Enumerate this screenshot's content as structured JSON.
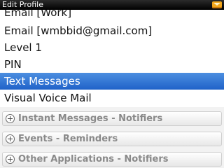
{
  "titlebar": {
    "title": "Edit Profile",
    "icon": "message-icon"
  },
  "list": {
    "items": [
      {
        "label": "Email [Work]"
      },
      {
        "label": "Email [wmbbid@gmail.com]"
      },
      {
        "label": "Level 1"
      },
      {
        "label": "PIN"
      },
      {
        "label": "Text Messages",
        "selected": true
      },
      {
        "label": "Visual Voice Mail"
      }
    ]
  },
  "groups": [
    {
      "label": "Instant Messages - Notifiers",
      "icon": "expand-plus-icon"
    },
    {
      "label": "Events - Reminders",
      "icon": "expand-plus-icon"
    },
    {
      "label": "Other Applications - Notifiers",
      "icon": "expand-plus-icon"
    }
  ],
  "colors": {
    "selection": "#2f74d6",
    "group_text": "#8a8a8a",
    "title_bg": "#000000"
  }
}
